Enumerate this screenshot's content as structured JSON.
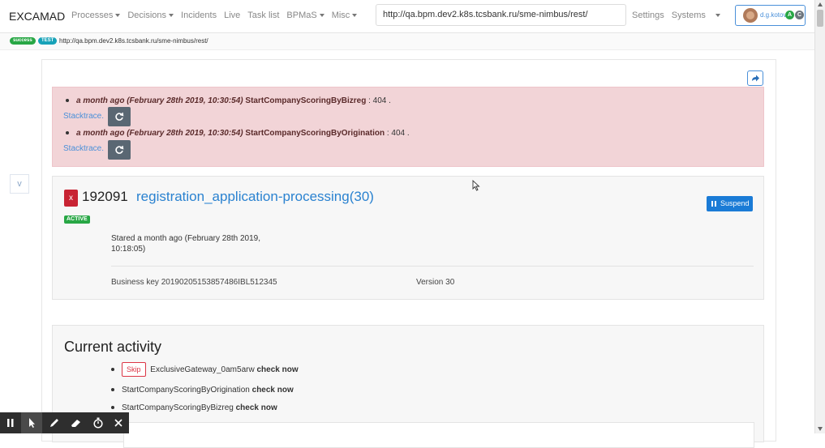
{
  "navbar": {
    "brand": "EXCAMAD",
    "items": [
      {
        "label": "Processes",
        "dropdown": true
      },
      {
        "label": "Decisions",
        "dropdown": true
      },
      {
        "label": "Incidents",
        "dropdown": false
      },
      {
        "label": "Live",
        "dropdown": false
      },
      {
        "label": "Task list",
        "dropdown": false
      },
      {
        "label": "BPMaS",
        "dropdown": true
      },
      {
        "label": "Misc",
        "dropdown": true
      }
    ],
    "url": "http://qa.bpm.dev2.k8s.tcsbank.ru/sme-nimbus/rest/",
    "settings": "Settings",
    "systems": "Systems",
    "help": "?",
    "user": {
      "name": "d.g.kotov",
      "badge_a": "A",
      "badge_c": "C"
    }
  },
  "subbar": {
    "status_pill": "success",
    "env_pill": "TEST",
    "url": "http://qa.bpm.dev2.k8s.tcsbank.ru/sme-nimbus/rest/"
  },
  "collapse_label": "v",
  "alerts": [
    {
      "time": "a month ago (February 28th 2019, 10:30:54)",
      "process": "StartCompanyScoringByBizreg",
      "code": ": 404 .",
      "stacktrace": "Stacktrace."
    },
    {
      "time": "a month ago (February 28th 2019, 10:30:54)",
      "process": "StartCompanyScoringByOrigination",
      "code": ": 404 .",
      "stacktrace": "Stacktrace."
    }
  ],
  "process": {
    "close_label": "x",
    "id": "192091",
    "name": "registration_application-processing(30)",
    "status": "ACTIVE",
    "suspend_label": "Suspend",
    "started": "Stared a month ago (February 28th 2019, 10:18:05)",
    "business_key": "Business key 20190205153857486IBL512345",
    "version": "Version 30"
  },
  "current_activity": {
    "title": "Current activity",
    "items": [
      {
        "skip": "Skip",
        "name": "ExclusiveGateway_0am5arw",
        "action": "check now"
      },
      {
        "skip": "",
        "name": "StartCompanyScoringByOrigination",
        "action": "check now"
      },
      {
        "skip": "",
        "name": "StartCompanyScoringByBizreg",
        "action": "check now"
      }
    ]
  },
  "toolbar_icons": [
    "pause-icon",
    "pointer-icon",
    "pen-icon",
    "eraser-icon",
    "timer-icon",
    "close-icon"
  ],
  "colors": {
    "link": "#4a90d9",
    "alert_bg": "#f2d4d7",
    "danger": "#c82333",
    "success": "#28a745",
    "primary": "#1a7bd6"
  }
}
